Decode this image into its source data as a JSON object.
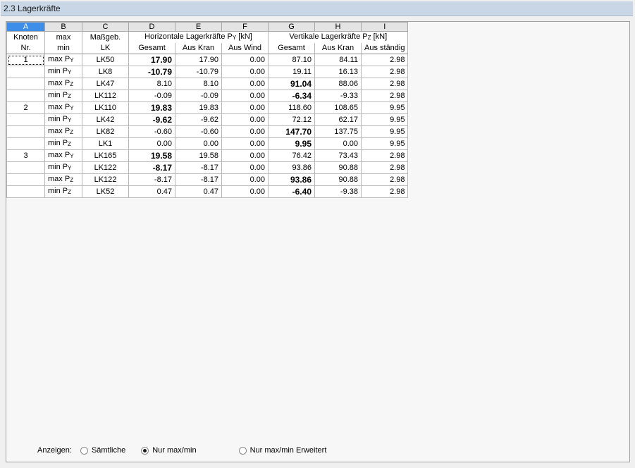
{
  "title": "2.3 Lagerkräfte",
  "columns": {
    "letters": [
      "A",
      "B",
      "C",
      "D",
      "E",
      "F",
      "G",
      "H",
      "I"
    ],
    "selected_letter": "A",
    "h1": {
      "knoten": "Knoten",
      "max": "max",
      "massgeb": "Maßgeb.",
      "horizontal": "Horizontale Lagerkräfte P",
      "horizontal_sub": "Y",
      "horizontal_unit": " [kN]",
      "vertical": "Vertikale Lagerkräfte P",
      "vertical_sub": "Z",
      "vertical_unit": " [kN]"
    },
    "h2": {
      "nr": "Nr.",
      "min": "min",
      "lk": "LK",
      "gesamt_h": "Gesamt",
      "aus_kran_h": "Aus Kran",
      "aus_wind": "Aus Wind",
      "gesamt_v": "Gesamt",
      "aus_kran_v": "Aus Kran",
      "aus_staendig": "Aus ständig"
    }
  },
  "rows": [
    {
      "node": "1",
      "type": "max",
      "sub": "Y",
      "lk": "LK50",
      "d": "17.90",
      "e": "17.90",
      "f": "0.00",
      "g": "87.10",
      "h": "84.11",
      "i": "2.98",
      "bold": "d"
    },
    {
      "node": "",
      "type": "min",
      "sub": "Y",
      "lk": "LK8",
      "d": "-10.79",
      "e": "-10.79",
      "f": "0.00",
      "g": "19.11",
      "h": "16.13",
      "i": "2.98",
      "bold": "d"
    },
    {
      "node": "",
      "type": "max",
      "sub": "Z",
      "lk": "LK47",
      "d": "8.10",
      "e": "8.10",
      "f": "0.00",
      "g": "91.04",
      "h": "88.06",
      "i": "2.98",
      "bold": "g"
    },
    {
      "node": "",
      "type": "min",
      "sub": "Z",
      "lk": "LK112",
      "d": "-0.09",
      "e": "-0.09",
      "f": "0.00",
      "g": "-6.34",
      "h": "-9.33",
      "i": "2.98",
      "bold": "g"
    },
    {
      "node": "2",
      "type": "max",
      "sub": "Y",
      "lk": "LK110",
      "d": "19.83",
      "e": "19.83",
      "f": "0.00",
      "g": "118.60",
      "h": "108.65",
      "i": "9.95",
      "bold": "d"
    },
    {
      "node": "",
      "type": "min",
      "sub": "Y",
      "lk": "LK42",
      "d": "-9.62",
      "e": "-9.62",
      "f": "0.00",
      "g": "72.12",
      "h": "62.17",
      "i": "9.95",
      "bold": "d"
    },
    {
      "node": "",
      "type": "max",
      "sub": "Z",
      "lk": "LK82",
      "d": "-0.60",
      "e": "-0.60",
      "f": "0.00",
      "g": "147.70",
      "h": "137.75",
      "i": "9.95",
      "bold": "g"
    },
    {
      "node": "",
      "type": "min",
      "sub": "Z",
      "lk": "LK1",
      "d": "0.00",
      "e": "0.00",
      "f": "0.00",
      "g": "9.95",
      "h": "0.00",
      "i": "9.95",
      "bold": "g"
    },
    {
      "node": "3",
      "type": "max",
      "sub": "Y",
      "lk": "LK165",
      "d": "19.58",
      "e": "19.58",
      "f": "0.00",
      "g": "76.42",
      "h": "73.43",
      "i": "2.98",
      "bold": "d"
    },
    {
      "node": "",
      "type": "min",
      "sub": "Y",
      "lk": "LK122",
      "d": "-8.17",
      "e": "-8.17",
      "f": "0.00",
      "g": "93.86",
      "h": "90.88",
      "i": "2.98",
      "bold": "d"
    },
    {
      "node": "",
      "type": "max",
      "sub": "Z",
      "lk": "LK122",
      "d": "-8.17",
      "e": "-8.17",
      "f": "0.00",
      "g": "93.86",
      "h": "90.88",
      "i": "2.98",
      "bold": "g"
    },
    {
      "node": "",
      "type": "min",
      "sub": "Z",
      "lk": "LK52",
      "d": "0.47",
      "e": "0.47",
      "f": "0.00",
      "g": "-6.40",
      "h": "-9.38",
      "i": "2.98",
      "bold": "g"
    }
  ],
  "row_label_prefix": "P",
  "footer": {
    "label": "Anzeigen:",
    "options": [
      "Sämtliche",
      "Nur max/min",
      "Nur max/min Erweitert"
    ],
    "selected": "Nur max/min"
  },
  "colors": {
    "title_bar": "#c8d6e6",
    "selected_column": "#3d8ee8",
    "header_gray": "#e4e4e4"
  }
}
